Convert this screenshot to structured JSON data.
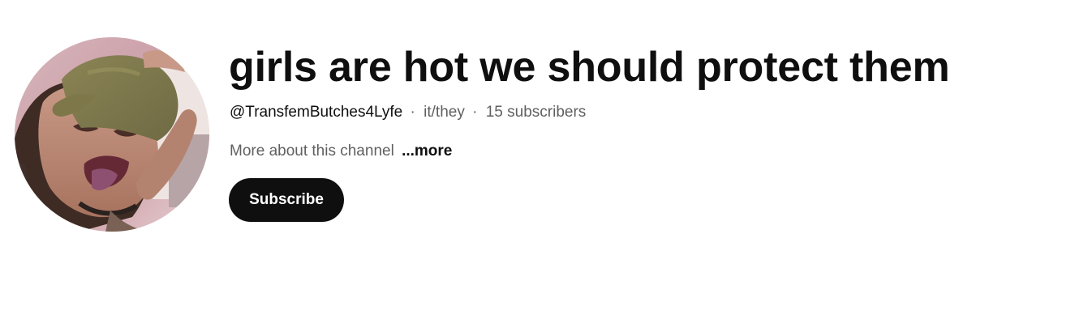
{
  "channel": {
    "name": "girls are hot we should protect them",
    "handle": "@TransfemButches4Lyfe",
    "pronouns": "it/they",
    "subscribers": "15 subscribers",
    "separator": "·",
    "description": "More about this channel",
    "more_label": "...more"
  },
  "actions": {
    "subscribe_label": "Subscribe"
  },
  "colors": {
    "title": "#0f0f0f",
    "secondary_text": "#606060",
    "subscribe_bg": "#0f0f0f",
    "subscribe_text": "#ffffff"
  }
}
